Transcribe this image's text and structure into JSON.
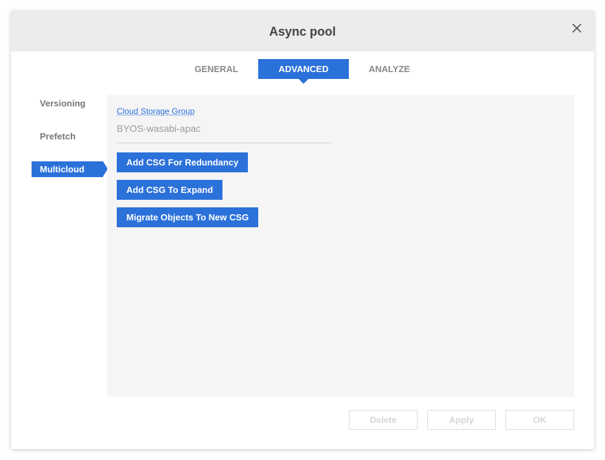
{
  "dialog": {
    "title": "Async pool",
    "close_icon": "close-icon"
  },
  "tabs": [
    {
      "label": "GENERAL",
      "active": false
    },
    {
      "label": "ADVANCED",
      "active": true
    },
    {
      "label": "ANALYZE",
      "active": false
    }
  ],
  "sidebar": {
    "items": [
      {
        "label": "Versioning",
        "active": false
      },
      {
        "label": "Prefetch",
        "active": false
      },
      {
        "label": "Multicloud",
        "active": true
      }
    ]
  },
  "multicloud": {
    "field_label": "Cloud Storage Group",
    "field_value": "BYOS-wasabi-apac",
    "buttons": {
      "redundancy": "Add CSG For Redundancy",
      "expand": "Add CSG To Expand",
      "migrate": "Migrate Objects To New CSG"
    }
  },
  "footer": {
    "delete": "Delete",
    "apply": "Apply",
    "ok": "OK"
  },
  "colors": {
    "accent": "#2b71da",
    "header_bg": "#ececec",
    "panel_bg": "#f5f5f5"
  }
}
